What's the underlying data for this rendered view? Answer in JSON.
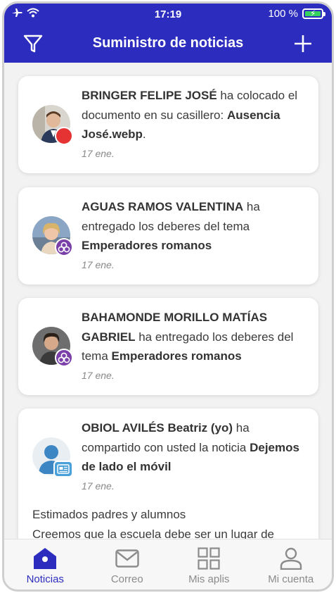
{
  "status_bar": {
    "time": "17:19",
    "battery": "100 %",
    "battery_level": 1.0
  },
  "header": {
    "title": "Suministro de noticias"
  },
  "colors": {
    "brand": "#2c2dbe",
    "badge_red": "#e53232",
    "badge_purple": "#7a3fa8",
    "badge_blue": "#4aa0d8",
    "battery": "#35d35d"
  },
  "feed": [
    {
      "name": "BRINGER FELIPE JOSÉ",
      "action": " ha colocado el documento en su casillero: ",
      "object": "Ausencia José.webp",
      "suffix": ".",
      "date": "17 ene.",
      "badge_icon": "red-dot-icon"
    },
    {
      "name": "AGUAS RAMOS VALENTINA",
      "action": " ha entregado los deberes del tema ",
      "object": "Emperadores romanos",
      "suffix": "",
      "date": "17 ene.",
      "badge_icon": "homework-icon"
    },
    {
      "name": "BAHAMONDE MORILLO MATÍAS GABRIEL",
      "action": " ha entregado los deberes del tema ",
      "object": "Emperadores romanos",
      "suffix": "",
      "date": "17 ene.",
      "badge_icon": "homework-icon"
    },
    {
      "name": "OBIOL AVILÉS Beatriz (yo)",
      "action": " ha compartido con usted la noticia ",
      "object": "Dejemos de lado el móvil",
      "suffix": "",
      "date": "17 ene.",
      "badge_icon": "news-icon",
      "body_line1": "Estimados padres y alumnos",
      "body_line2": "Creemos que la escuela debe ser un lugar de"
    }
  ],
  "nav": [
    {
      "label": "Noticias",
      "icon": "home-icon",
      "active": true
    },
    {
      "label": "Correo",
      "icon": "mail-icon",
      "active": false
    },
    {
      "label": "Mis aplis",
      "icon": "apps-grid-icon",
      "active": false
    },
    {
      "label": "Mi cuenta",
      "icon": "user-icon",
      "active": false
    }
  ]
}
